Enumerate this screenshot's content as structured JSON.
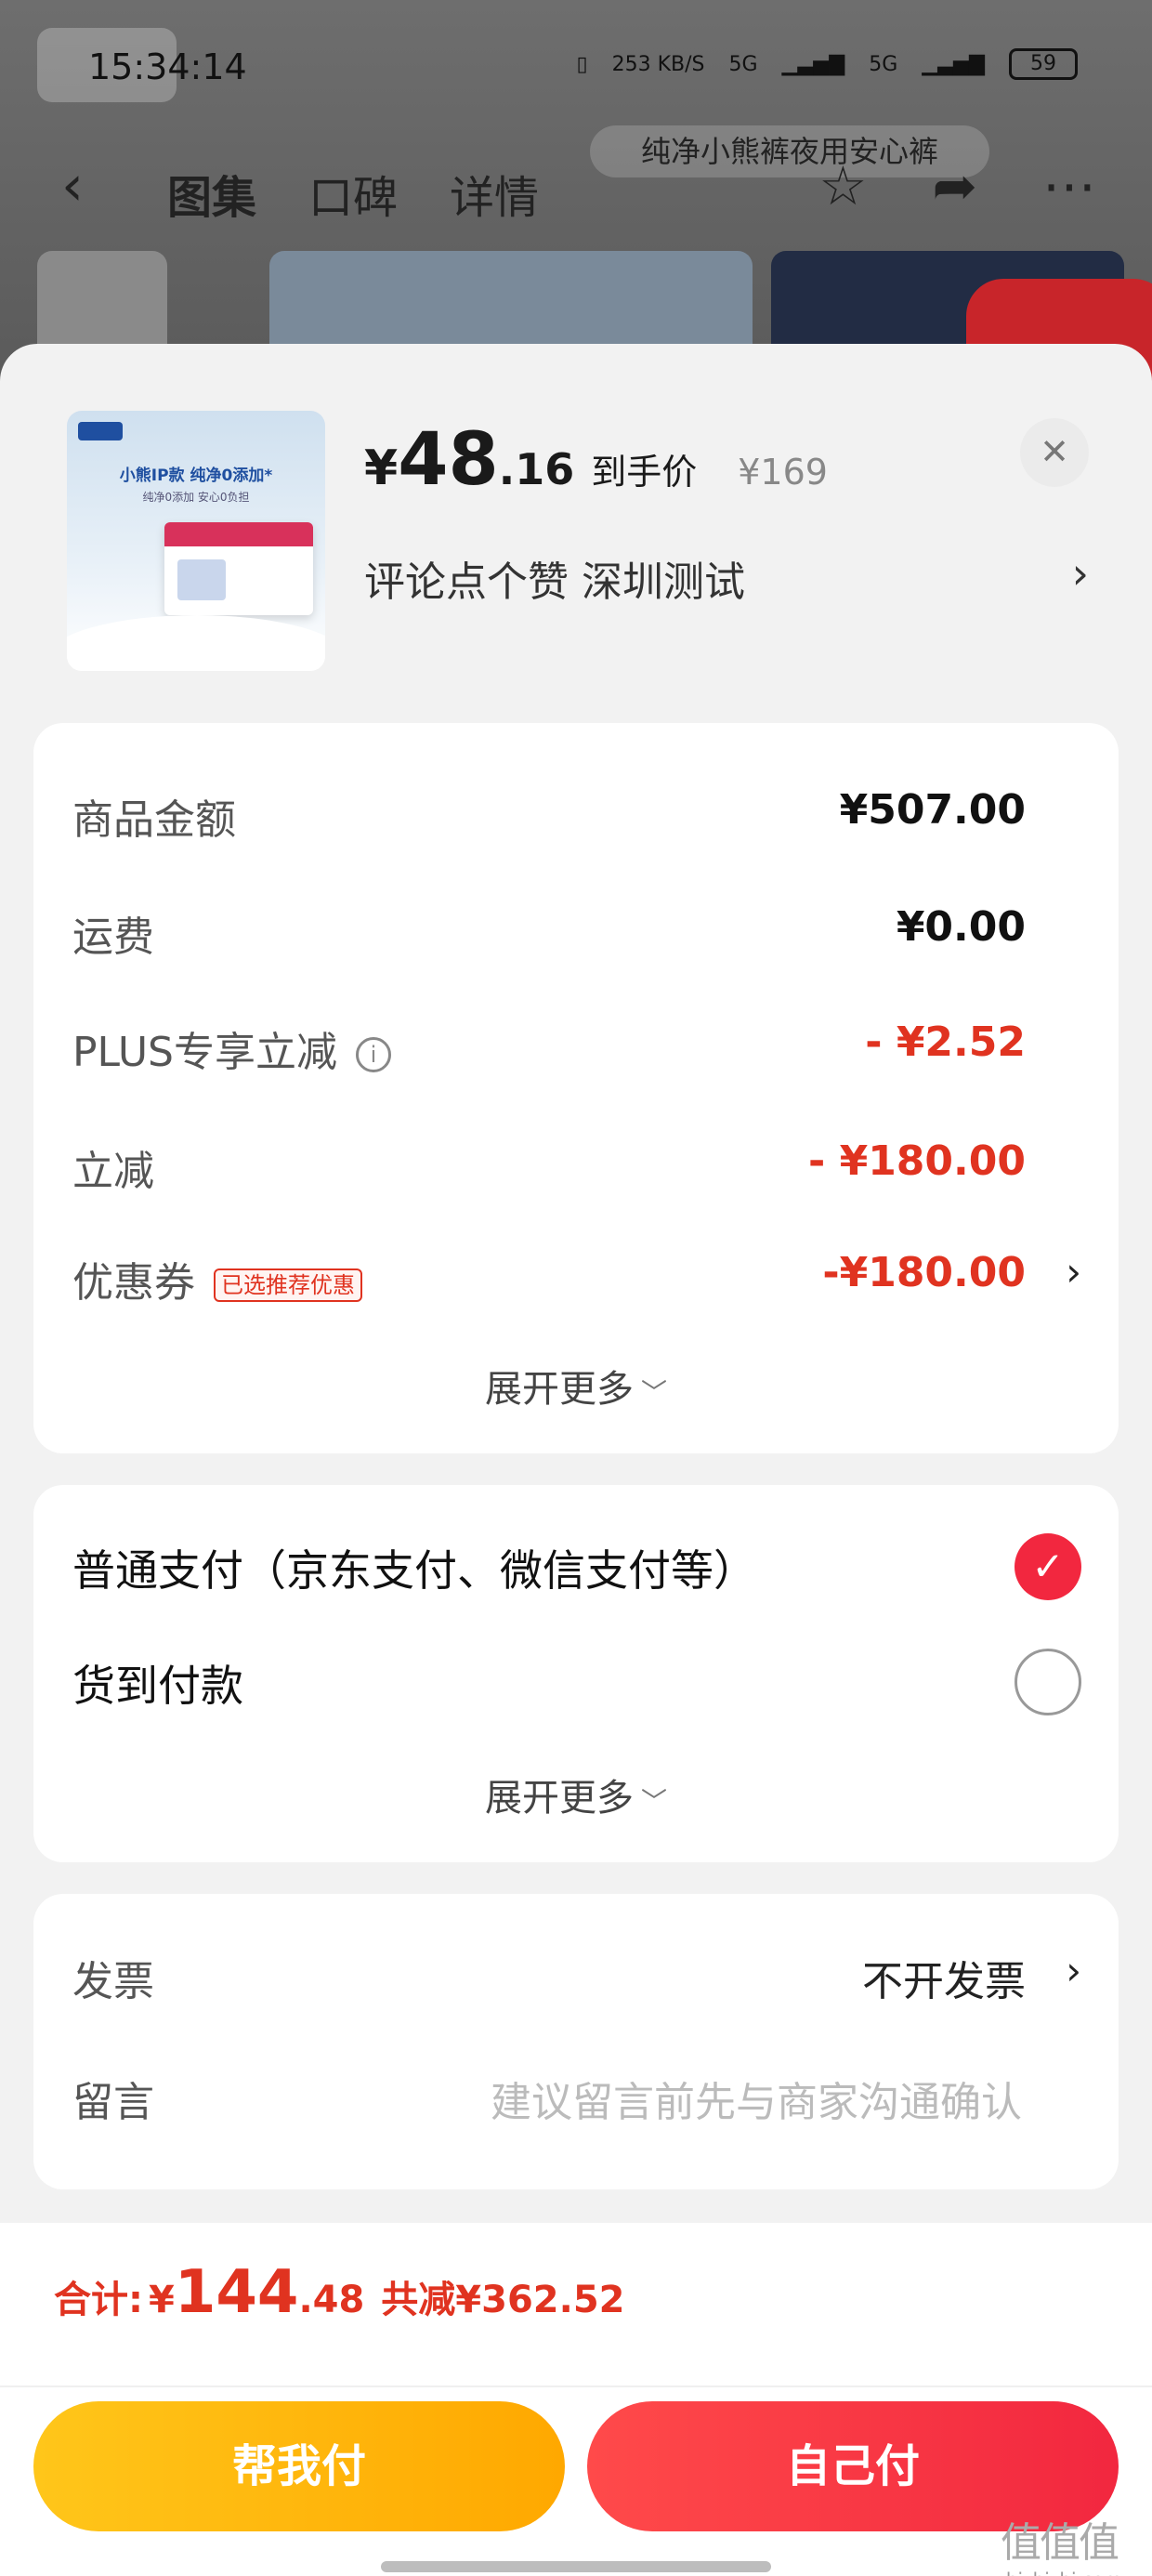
{
  "status_bar": {
    "time": "15:34:14",
    "speed": "253 KB/S",
    "network1": "5G",
    "network2": "5G",
    "battery": "59"
  },
  "nav": {
    "tabs": [
      "图集",
      "口碑",
      "详情"
    ],
    "banner": "纯净小熊裤夜用安心裤"
  },
  "product": {
    "image_headline": "小熊IP款 纯净0添加*",
    "image_sub": "纯净0添加 安心0负担",
    "price_currency": "¥",
    "price_integer": "48",
    "price_decimal": ".16",
    "price_tag": "到手价",
    "original_price": "¥169",
    "spec": "评论点个赞  深圳测试"
  },
  "summary": {
    "rows": [
      {
        "label": "商品金额",
        "value": "¥507.00"
      },
      {
        "label": "运费",
        "value": "¥0.00"
      },
      {
        "label": "PLUS专享立减",
        "value": "- ¥2.52"
      },
      {
        "label": "立减",
        "value": "- ¥180.00"
      },
      {
        "label": "优惠券",
        "badge": "已选推荐优惠",
        "value": "-¥180.00"
      }
    ],
    "expand": "展开更多"
  },
  "payment": {
    "options": [
      {
        "label": "普通支付（京东支付、微信支付等）",
        "checked": true
      },
      {
        "label": "货到付款",
        "checked": false
      }
    ],
    "expand": "展开更多"
  },
  "extras": {
    "invoice_label": "发票",
    "invoice_value": "不开发票",
    "message_label": "留言",
    "message_placeholder": "建议留言前先与商家沟通确认"
  },
  "footer": {
    "total_label": "合计:",
    "total_currency": "¥",
    "total_integer": "144",
    "total_decimal": ".48",
    "saved": "共减¥362.52",
    "help_pay": "帮我付",
    "self_pay": "自己付"
  },
  "watermark": "zhizhizhi.com",
  "colors": {
    "accent_red": "#e03320",
    "check_red": "#f2273f",
    "help_yellow": "#ffb800"
  }
}
